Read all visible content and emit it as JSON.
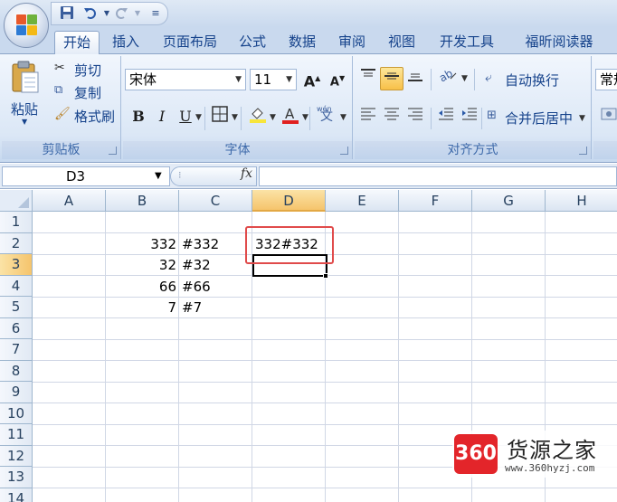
{
  "title_bar": {
    "quick_access": [
      "save-icon",
      "undo-icon",
      "redo-icon",
      "customize-icon"
    ]
  },
  "tabs": [
    {
      "label": "开始",
      "active": true
    },
    {
      "label": "插入"
    },
    {
      "label": "页面布局"
    },
    {
      "label": "公式"
    },
    {
      "label": "数据"
    },
    {
      "label": "审阅"
    },
    {
      "label": "视图"
    },
    {
      "label": "开发工具"
    },
    {
      "label": "福昕阅读器"
    }
  ],
  "ribbon": {
    "clipboard": {
      "paste": "粘贴",
      "cut": "剪切",
      "copy": "复制",
      "format_painter": "格式刷",
      "label": "剪贴板"
    },
    "font": {
      "font_name": "宋体",
      "font_size": "11",
      "bold": "B",
      "italic": "I",
      "underline": "U",
      "grow": "A",
      "shrink": "A",
      "phonetic": "wén",
      "label": "字体",
      "colors": {
        "fill": "#f7e53b",
        "font": "#e02020"
      }
    },
    "alignment": {
      "wrap_text": "自动换行",
      "merge_center": "合并后居中",
      "label": "对齐方式"
    },
    "number": {
      "format": "常规"
    }
  },
  "formula_bar": {
    "name_box": "D3",
    "fx": "fx",
    "formula": ""
  },
  "sheet": {
    "columns": [
      "A",
      "B",
      "C",
      "D",
      "E",
      "F",
      "G",
      "H"
    ],
    "selected_column": "D",
    "rows": [
      "1",
      "2",
      "3",
      "4",
      "5",
      "6",
      "7",
      "8",
      "9",
      "10",
      "11",
      "12",
      "13",
      "14"
    ],
    "selected_row": "3",
    "cells": {
      "B2": "332",
      "C2": "#332",
      "D2": "332#332",
      "B3": "32",
      "C3": "#32",
      "B4": "66",
      "C4": "#66",
      "B5": "7",
      "C5": "#7"
    },
    "active_cell": "D3",
    "highlight_color": "#e04b4b"
  },
  "watermark": {
    "badge": "360",
    "name": "货源之家",
    "url": "www.360hyzj.com"
  }
}
